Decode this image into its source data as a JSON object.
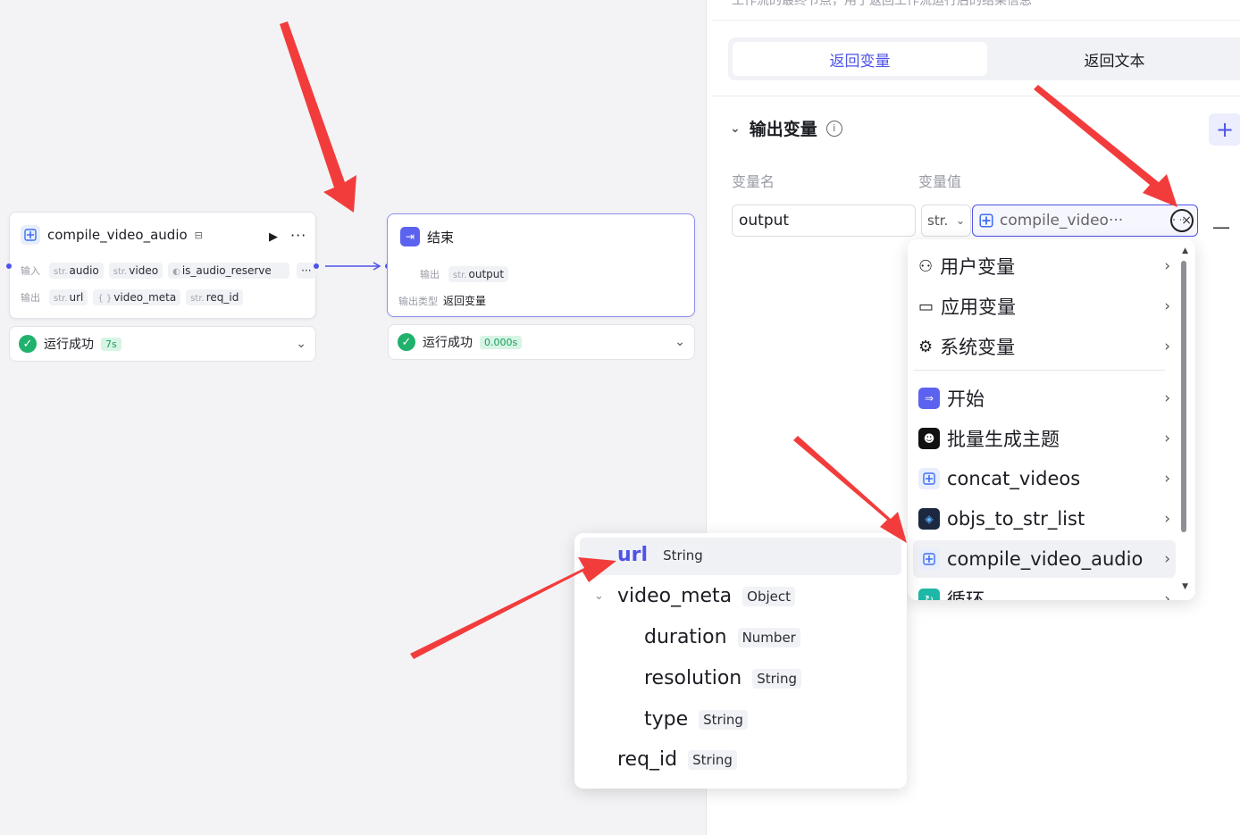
{
  "canvas": {
    "node1": {
      "title": "compile_video_audio",
      "input_label": "输入",
      "output_label": "输出",
      "inputs": [
        {
          "type": "str.",
          "name": "audio"
        },
        {
          "type": "str.",
          "name": "video"
        },
        {
          "type": "",
          "name": "is_audio_reserve"
        }
      ],
      "more": "···",
      "outputs": [
        {
          "type": "str.",
          "name": "url"
        },
        {
          "type": "{ }",
          "name": "video_meta"
        },
        {
          "type": "str.",
          "name": "req_id"
        }
      ],
      "status": "运行成功",
      "time": "7s"
    },
    "node2": {
      "title": "结束",
      "output_label": "输出",
      "output": {
        "type": "str.",
        "name": "output"
      },
      "output_type_label": "输出类型",
      "output_type_value": "返回变量",
      "status": "运行成功",
      "time": "0.000s"
    }
  },
  "panel": {
    "description": "工作流的最终节点，用于返回工作流运行后的结果信息",
    "tabs": [
      {
        "label": "返回变量",
        "active": true
      },
      {
        "label": "返回文本",
        "active": false
      }
    ],
    "section_title": "输出变量",
    "col_name": "变量名",
    "col_value": "变量值",
    "row": {
      "name": "output",
      "type": "str.",
      "ref": "compile_video···",
      "ref_dot": "·",
      "clear": "×"
    }
  },
  "dropdown": {
    "items": [
      {
        "label": "用户变量",
        "icon": "user-icon"
      },
      {
        "label": "应用变量",
        "icon": "folder-icon"
      },
      {
        "label": "系统变量",
        "icon": "gear-icon"
      },
      {
        "label": "开始",
        "icon": "start-node-icon"
      },
      {
        "label": "批量生成主题",
        "icon": "bot-icon"
      },
      {
        "label": "concat_videos",
        "icon": "plugin-icon"
      },
      {
        "label": "objs_to_str_list",
        "icon": "code-icon"
      },
      {
        "label": "compile_video_audio",
        "icon": "plugin-icon"
      },
      {
        "label": "循环",
        "icon": "loop-icon"
      }
    ]
  },
  "subfields": [
    {
      "name": "url",
      "type": "String",
      "level": 0,
      "selected": true
    },
    {
      "name": "video_meta",
      "type": "Object",
      "level": 0,
      "expanded": true
    },
    {
      "name": "duration",
      "type": "Number",
      "level": 1
    },
    {
      "name": "resolution",
      "type": "String",
      "level": 1
    },
    {
      "name": "type",
      "type": "String",
      "level": 1
    },
    {
      "name": "req_id",
      "type": "String",
      "level": 0
    }
  ],
  "colors": {
    "accent": "#4d53e8",
    "success": "#20b26c",
    "arrow": "#f23c3c"
  }
}
